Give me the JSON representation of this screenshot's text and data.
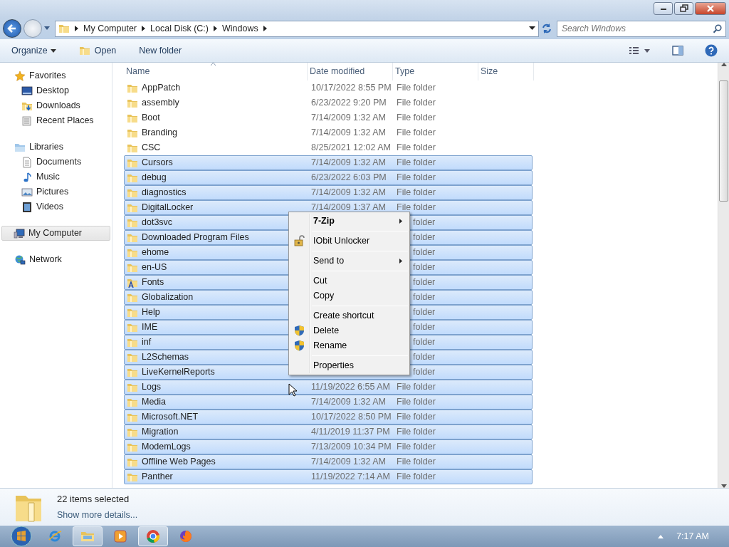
{
  "address_bar": {
    "segments": [
      "My Computer",
      "Local Disk (C:)",
      "Windows"
    ]
  },
  "search": {
    "placeholder": "Search Windows"
  },
  "toolbar": {
    "buttons": [
      {
        "label": "Organize",
        "kind": "dropdown"
      },
      {
        "label": "Open",
        "kind": "folder"
      },
      {
        "label": "New folder",
        "kind": "plain"
      }
    ]
  },
  "sidebar": {
    "items": [
      {
        "label": "Favorites",
        "kind": "star",
        "selected": false,
        "children": [
          {
            "label": "Desktop",
            "kind": "desktop",
            "selected": false
          },
          {
            "label": "Downloads",
            "kind": "downloads",
            "selected": false
          },
          {
            "label": "Recent Places",
            "kind": "recent",
            "selected": false
          }
        ]
      },
      {
        "label": "Libraries",
        "kind": "library",
        "selected": false,
        "children": [
          {
            "label": "Documents",
            "kind": "document",
            "selected": false
          },
          {
            "label": "Music",
            "kind": "music",
            "selected": false
          },
          {
            "label": "Pictures",
            "kind": "pictures",
            "selected": false
          },
          {
            "label": "Videos",
            "kind": "videos",
            "selected": false
          }
        ]
      },
      {
        "label": "My Computer",
        "kind": "computer",
        "selected": true
      },
      {
        "label": "Network",
        "kind": "network",
        "selected": false
      }
    ]
  },
  "table": {
    "columns": [
      "Name",
      "Date modified",
      "Type",
      "Size"
    ],
    "rows": [
      {
        "name": "AppPatch",
        "kind": "folder",
        "date": "10/17/2022 8:55 PM",
        "type": "File folder",
        "selected": false
      },
      {
        "name": "assembly",
        "kind": "folder",
        "date": "6/23/2022 9:20 PM",
        "type": "File folder",
        "selected": false
      },
      {
        "name": "Boot",
        "kind": "folder",
        "date": "7/14/2009 1:32 AM",
        "type": "File folder",
        "selected": false
      },
      {
        "name": "Branding",
        "kind": "folder",
        "date": "7/14/2009 1:32 AM",
        "type": "File folder",
        "selected": false
      },
      {
        "name": "CSC",
        "kind": "folder",
        "date": "8/25/2021 12:02 AM",
        "type": "File folder",
        "selected": false
      },
      {
        "name": "Cursors",
        "kind": "folder",
        "date": "7/14/2009 1:32 AM",
        "type": "File folder",
        "selected": true
      },
      {
        "name": "debug",
        "kind": "folder",
        "date": "6/23/2022 6:03 PM",
        "type": "File folder",
        "selected": true
      },
      {
        "name": "diagnostics",
        "kind": "folder",
        "date": "7/14/2009 1:32 AM",
        "type": "File folder",
        "selected": true
      },
      {
        "name": "DigitalLocker",
        "kind": "folder",
        "date": "7/14/2009 1:37 AM",
        "type": "File folder",
        "selected": true
      },
      {
        "name": "dot3svc",
        "kind": "folder",
        "type": "folder",
        "selected": true
      },
      {
        "name": "Downloaded Program Files",
        "kind": "folder",
        "type": "folder",
        "selected": true
      },
      {
        "name": "ehome",
        "kind": "folder",
        "type": "folder",
        "selected": true
      },
      {
        "name": "en-US",
        "kind": "folder",
        "type": "folder",
        "selected": true
      },
      {
        "name": "Fonts",
        "kind": "fonts",
        "type": "folder",
        "selected": true
      },
      {
        "name": "Globalization",
        "kind": "folder",
        "type": "folder",
        "selected": true
      },
      {
        "name": "Help",
        "kind": "folder",
        "type": "folder",
        "selected": true
      },
      {
        "name": "IME",
        "kind": "folder",
        "type": "folder",
        "selected": true
      },
      {
        "name": "inf",
        "kind": "folder",
        "type": "folder",
        "selected": true
      },
      {
        "name": "L2Schemas",
        "kind": "folder",
        "type": "folder",
        "selected": true
      },
      {
        "name": "LiveKernelReports",
        "kind": "folder",
        "type": "folder",
        "selected": true
      },
      {
        "name": "Logs",
        "kind": "folder",
        "date": "11/19/2022 6:55 AM",
        "type": "File folder",
        "selected": true
      },
      {
        "name": "Media",
        "kind": "folder",
        "date": "7/14/2009 1:32 AM",
        "type": "File folder",
        "selected": true
      },
      {
        "name": "Microsoft.NET",
        "kind": "folder",
        "date": "10/17/2022 8:50 PM",
        "type": "File folder",
        "selected": true
      },
      {
        "name": "Migration",
        "kind": "folder",
        "date": "4/11/2019 11:37 PM",
        "type": "File folder",
        "selected": true
      },
      {
        "name": "ModemLogs",
        "kind": "folder",
        "date": "7/13/2009 10:34 PM",
        "type": "File folder",
        "selected": true
      },
      {
        "name": "Offline Web Pages",
        "kind": "folder",
        "date": "7/14/2009 1:32 AM",
        "type": "File folder",
        "selected": true
      },
      {
        "name": "Panther",
        "kind": "folder",
        "date": "11/19/2022 7:14 AM",
        "type": "File folder",
        "selected": true
      }
    ]
  },
  "context_menu": {
    "groups": [
      [
        {
          "label": "7-Zip",
          "kind": "submenu",
          "bold": true
        }
      ],
      [
        {
          "label": "IObit Unlocker",
          "kind": "lock",
          "bold": false
        }
      ],
      [
        {
          "label": "Send to",
          "kind": "submenu",
          "bold": false
        }
      ],
      [
        {
          "label": "Cut",
          "kind": "plain",
          "bold": false
        },
        {
          "label": "Copy",
          "kind": "plain",
          "bold": false
        }
      ],
      [
        {
          "label": "Create shortcut",
          "kind": "plain",
          "bold": false
        },
        {
          "label": "Delete",
          "kind": "shield",
          "bold": false
        },
        {
          "label": "Rename",
          "kind": "shield",
          "bold": false
        }
      ],
      [
        {
          "label": "Properties",
          "kind": "plain",
          "bold": false
        }
      ]
    ]
  },
  "details": {
    "summary": "22 items selected",
    "link": "Show more details..."
  },
  "taskbar": {
    "apps": [
      {
        "kind": "ie",
        "active": false
      },
      {
        "kind": "explorer",
        "active": true
      },
      {
        "kind": "media",
        "active": false
      },
      {
        "kind": "chrome",
        "active": true
      },
      {
        "kind": "firefox",
        "active": false
      }
    ],
    "clock": "7:17 AM"
  }
}
